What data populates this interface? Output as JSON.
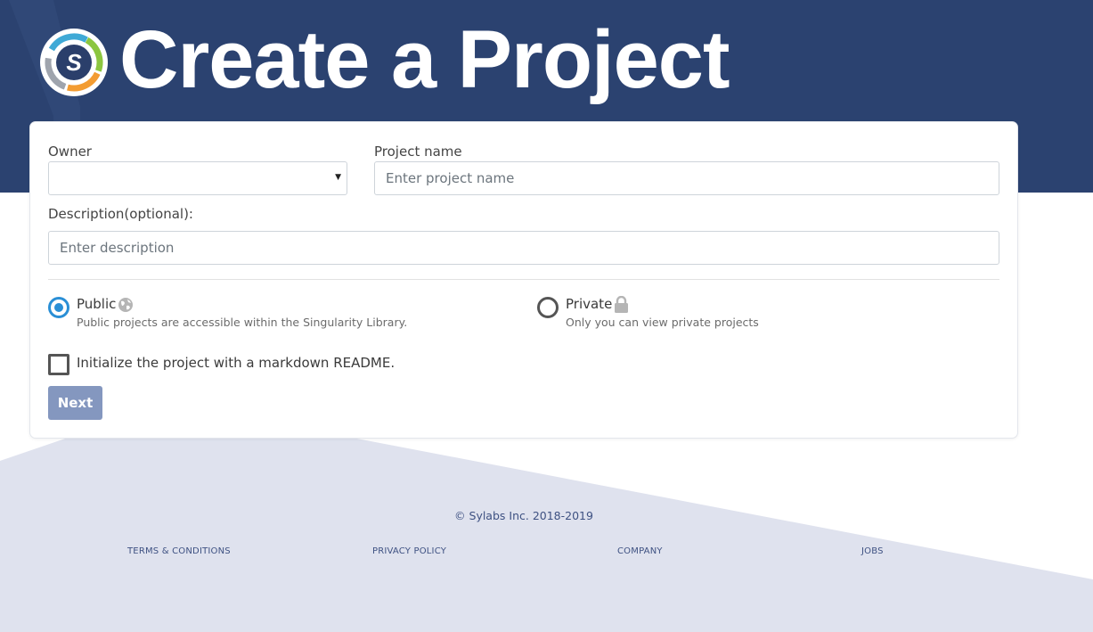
{
  "header": {
    "title": "Create a Project",
    "logo_letter": "S",
    "logo_icon": "sylabs-logo-icon"
  },
  "form": {
    "owner_label": "Owner",
    "owner_value": "",
    "project_name_label": "Project name",
    "project_name_placeholder": "Enter project name",
    "project_name_value": "",
    "description_label": "Description(optional):",
    "description_placeholder": "Enter description",
    "description_value": "",
    "visibility": {
      "selected": "public",
      "public_label": "Public",
      "public_icon": "globe-icon",
      "public_desc": "Public projects are accessible within the Singularity Library.",
      "private_label": "Private",
      "private_icon": "lock-icon",
      "private_desc": "Only you can view private projects"
    },
    "readme_label": "Initialize the project with a markdown README.",
    "readme_checked": false,
    "next_label": "Next"
  },
  "footer": {
    "copyright": "© Sylabs Inc. 2018-2019",
    "links": [
      "TERMS & CONDITIONS",
      "PRIVACY POLICY",
      "COMPANY",
      "JOBS"
    ]
  },
  "colors": {
    "header_bg": "#2b4270",
    "accent": "#2a8fd6",
    "button_bg": "#8497bf",
    "footer_bg": "#dfe2ee",
    "link": "#3e5182"
  }
}
